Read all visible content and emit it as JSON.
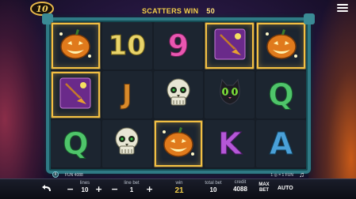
{
  "header": {
    "logo": "10",
    "scatters_label": "SCATTERS WIN",
    "scatters_value": "50"
  },
  "reels": [
    [
      "pumpkin-scatter",
      "10",
      "9",
      "broom-scatter",
      "pumpkin-scatter"
    ],
    [
      "broom-scatter",
      "J",
      "skull",
      "black-cat",
      "Q"
    ],
    [
      "Q",
      "skull",
      "pumpkin-scatter",
      "K",
      "A"
    ]
  ],
  "winning_cells": [
    "0-0",
    "0-3",
    "0-4",
    "1-0",
    "2-2"
  ],
  "info": {
    "left_text": "FUN 4088",
    "right_text": "1 ◎ = 1 FUN"
  },
  "controls": {
    "lines_label": "lines",
    "lines_value": "10",
    "linebet_label": "line bet",
    "linebet_value": "1",
    "win_label": "win",
    "win_value": "21",
    "totalbet_label": "total bet",
    "totalbet_value": "10",
    "credit_label": "credit",
    "credit_value": "4088",
    "maxbet_label": "MAX BET",
    "auto_label": "AUTO",
    "minus": "−",
    "plus": "+"
  },
  "colors": {
    "frame": "#2f7a85",
    "win_highlight": "#f3c043",
    "scatter_text": "#f4d04a"
  }
}
